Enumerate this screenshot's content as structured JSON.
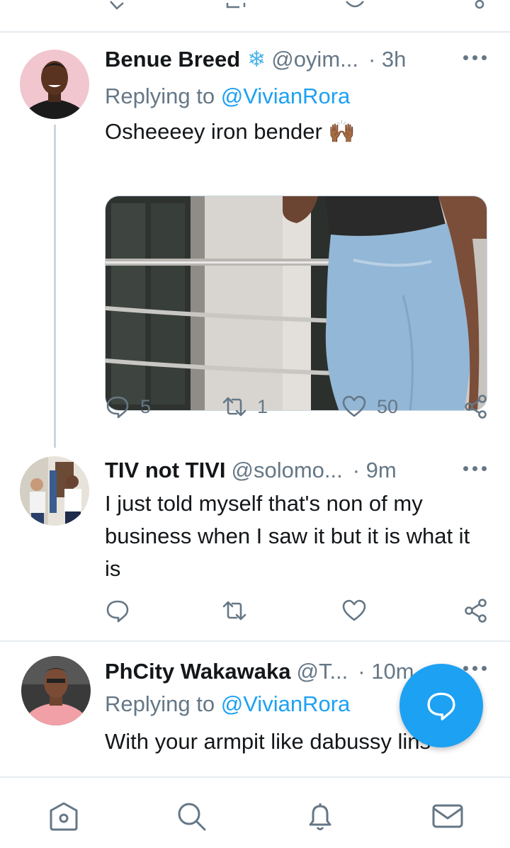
{
  "tweets": [
    {
      "name": "Benue Breed",
      "name_emoji": "❄",
      "handle": "@oyim...",
      "time": "· 3h",
      "replying_prefix": "Replying to ",
      "replying_to": "@VivianRora",
      "text": "Osheeeey iron bender 🙌🏾",
      "replies": "5",
      "retweets": "1",
      "likes": "50"
    },
    {
      "name": "TIV not TIVI",
      "handle": "@solomo...",
      "time": "· 9m",
      "text": "I just told myself that's non of my business when I saw it but it is what it is",
      "replies": "",
      "retweets": "",
      "likes": ""
    },
    {
      "name": "PhCity Wakawaka",
      "handle": "@T...",
      "time": "· 10m",
      "replying_prefix": "Replying to ",
      "replying_to": "@VivianRora",
      "text": "With your armpit like dabussy lins"
    }
  ],
  "icons": {
    "reply": "reply-icon",
    "retweet": "retweet-icon",
    "like": "heart-icon",
    "share": "share-icon",
    "more": "more-icon",
    "compose": "compose-reply-icon",
    "home": "home-icon",
    "search": "search-icon",
    "notifications": "bell-icon",
    "messages": "mail-icon"
  },
  "colors": {
    "accent": "#1da1f2",
    "secondary_text": "#657786",
    "divider": "#e6ecf0"
  }
}
